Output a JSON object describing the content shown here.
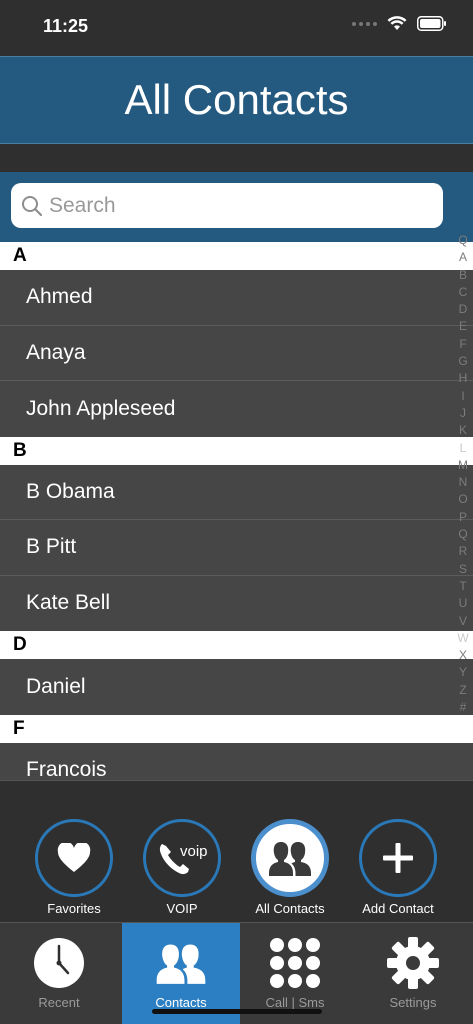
{
  "status_bar": {
    "time": "11:25"
  },
  "header": {
    "title": "All Contacts"
  },
  "search": {
    "placeholder": "Search",
    "value": ""
  },
  "contacts": {
    "sections": [
      {
        "letter": "A",
        "items": [
          "Ahmed",
          "Anaya",
          "John Appleseed"
        ]
      },
      {
        "letter": "B",
        "items": [
          "B Obama",
          "B Pitt",
          "Kate Bell"
        ]
      },
      {
        "letter": "D",
        "items": [
          "Daniel"
        ]
      },
      {
        "letter": "F",
        "items": [
          "Francois"
        ]
      }
    ]
  },
  "index_letters": [
    "Q",
    "A",
    "B",
    "C",
    "D",
    "E",
    "F",
    "G",
    "H",
    "I",
    "J",
    "K",
    "L",
    "M",
    "N",
    "O",
    "P",
    "Q",
    "R",
    "S",
    "T",
    "U",
    "V",
    "W",
    "X",
    "Y",
    "Z",
    "#"
  ],
  "actions": [
    {
      "label": "Favorites",
      "icon": "heart-icon"
    },
    {
      "label": "VOIP",
      "icon": "voip-phone-icon",
      "icon_text": "voip"
    },
    {
      "label": "All Contacts",
      "icon": "contacts-icon",
      "active": true
    },
    {
      "label": "Add Contact",
      "icon": "plus-icon"
    }
  ],
  "tabs": [
    {
      "label": "Recent",
      "icon": "clock-icon"
    },
    {
      "label": "Contacts",
      "icon": "contacts-icon",
      "active": true
    },
    {
      "label": "Call | Sms",
      "icon": "keypad-icon"
    },
    {
      "label": "Settings",
      "icon": "gear-icon"
    }
  ],
  "colors": {
    "header_blue": "#245a7f",
    "accent_blue": "#2b7fc2",
    "row_gray": "#464646",
    "background": "#2f2f2f"
  }
}
